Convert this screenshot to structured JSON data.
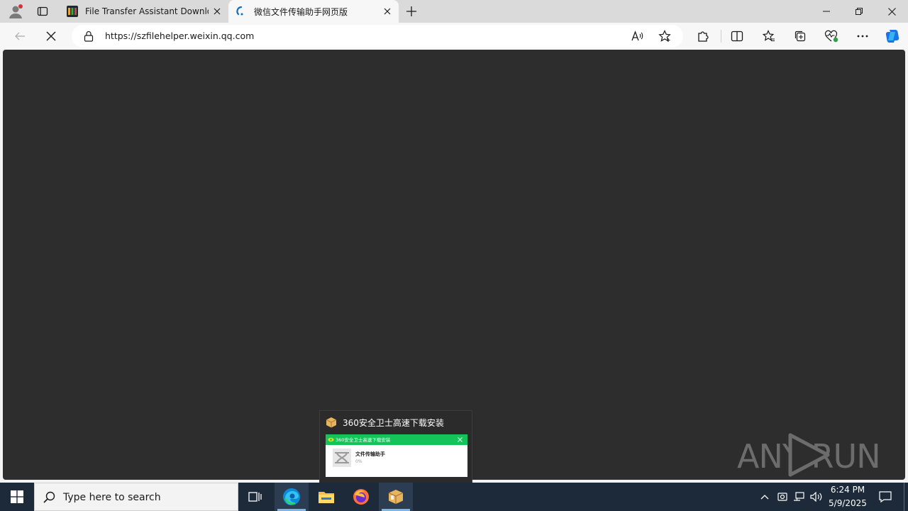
{
  "browser": {
    "tabs": [
      {
        "title": "File Transfer Assistant Download",
        "favicon": "app-favicon-icon"
      },
      {
        "title": "微信文件传输助手网页版",
        "favicon": "loading-spinner-icon"
      }
    ],
    "url": "https://szfilehelper.weixin.qq.com",
    "accent": "#0078d4"
  },
  "popup": {
    "title": "360安全卫士高速下载安装",
    "preview_header": "360安全卫士高速下载安装",
    "preview_item": "文件传输助手",
    "preview_progress": "0%"
  },
  "watermark": {
    "text": "ANY RUN"
  },
  "taskbar": {
    "search_placeholder": "Type here to search",
    "time": "6:24 PM",
    "date": "5/9/2025"
  }
}
